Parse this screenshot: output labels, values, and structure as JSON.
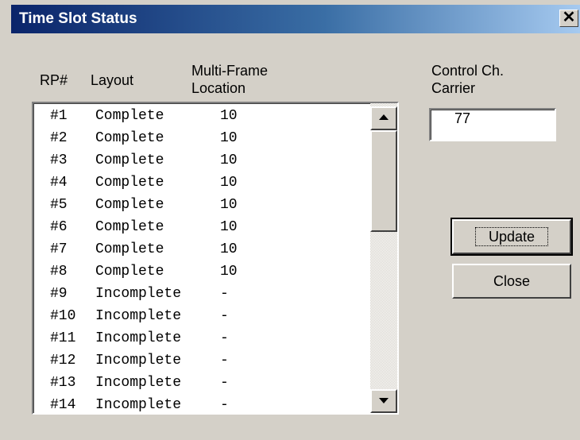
{
  "window": {
    "title": "Time Slot Status",
    "close_glyph": "✕"
  },
  "list": {
    "headers": {
      "rp": "RP#",
      "layout": "Layout",
      "location_line1": "Multi-Frame",
      "location_line2": "Location"
    },
    "rows": [
      {
        "rp": "#1",
        "layout": "Complete",
        "location": "10"
      },
      {
        "rp": "#2",
        "layout": "Complete",
        "location": "10"
      },
      {
        "rp": "#3",
        "layout": "Complete",
        "location": "10"
      },
      {
        "rp": "#4",
        "layout": "Complete",
        "location": "10"
      },
      {
        "rp": "#5",
        "layout": "Complete",
        "location": "10"
      },
      {
        "rp": "#6",
        "layout": "Complete",
        "location": "10"
      },
      {
        "rp": "#7",
        "layout": "Complete",
        "location": "10"
      },
      {
        "rp": "#8",
        "layout": "Complete",
        "location": "10"
      },
      {
        "rp": "#9",
        "layout": "Incomplete",
        "location": "-"
      },
      {
        "rp": "#10",
        "layout": "Incomplete",
        "location": "-"
      },
      {
        "rp": "#11",
        "layout": "Incomplete",
        "location": "-"
      },
      {
        "rp": "#12",
        "layout": "Incomplete",
        "location": "-"
      },
      {
        "rp": "#13",
        "layout": "Incomplete",
        "location": "-"
      },
      {
        "rp": "#14",
        "layout": "Incomplete",
        "location": "-"
      }
    ]
  },
  "control": {
    "label_line1": "Control Ch.",
    "label_line2": "Carrier",
    "value": "77"
  },
  "buttons": {
    "update": "Update",
    "close": "Close"
  },
  "icons": {
    "scroll_up": "scroll-up-arrow-icon",
    "scroll_down": "scroll-down-arrow-icon",
    "close": "close-icon"
  },
  "colors": {
    "titlebar_start": "#0a246a",
    "titlebar_end": "#a6caf0",
    "face": "#d4d0c8"
  }
}
